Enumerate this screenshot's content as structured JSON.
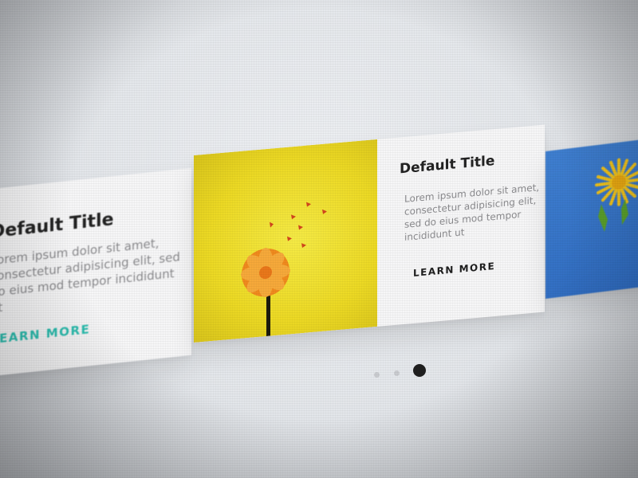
{
  "carousel": {
    "cards": [
      {
        "title": "Default Title",
        "body": "Lorem ipsum dolor sit amet, consectetur adipisicing elit, sed do eius mod tempor incididunt ut",
        "cta": "LEARN MORE",
        "cta_color": "#2bbfb0",
        "image": "none"
      },
      {
        "title": "Default Title",
        "body": "Lorem ipsum dolor sit amet, consectetur adipisicing elit, sed do eius mod tempor incididunt ut",
        "cta": "LEARN MORE",
        "cta_color": "#1e1e1e",
        "image": "orange-lollipop-flower-on-yellow"
      },
      {
        "image": "yellow-dandelion-on-blue"
      }
    ],
    "pagination": {
      "total": 3,
      "active_index": 2
    }
  },
  "colors": {
    "accent_teal": "#2bbfb0",
    "card_bg": "#f6f6f7",
    "image_yellow": "#f0e030",
    "image_blue": "#3375c8",
    "dot_active": "#1f1f1f",
    "dot_inactive": "#c9cbcf"
  }
}
